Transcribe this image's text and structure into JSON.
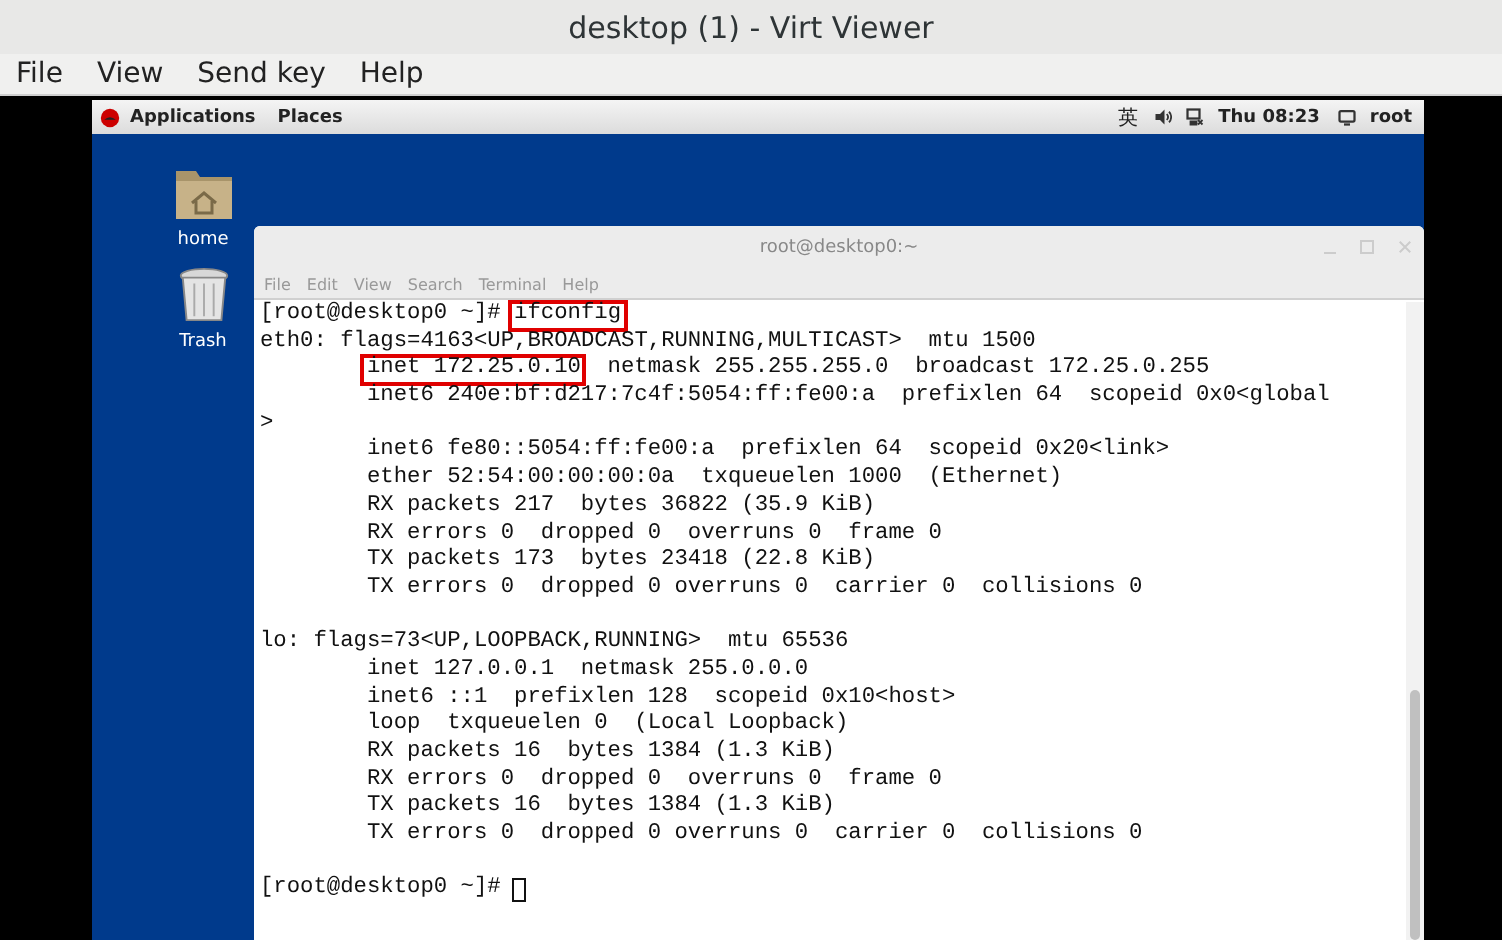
{
  "window": {
    "title": "desktop (1) - Virt Viewer"
  },
  "menu": [
    "File",
    "View",
    "Send key",
    "Help"
  ],
  "guest": {
    "panel": {
      "items": [
        "Applications",
        "Places"
      ],
      "input_method": "英",
      "clock": "Thu 08:23",
      "user": "root"
    },
    "desktop_icons": [
      {
        "kind": "folder",
        "label": "home"
      },
      {
        "kind": "trash",
        "label": "Trash"
      }
    ],
    "terminal": {
      "title": "root@desktop0:~",
      "menu": [
        "File",
        "Edit",
        "View",
        "Search",
        "Terminal",
        "Help"
      ],
      "cursor": true,
      "lines": [
        {
          "indented": false,
          "gap_before": false,
          "parts": [
            {
              "text": "[root@desktop0 ~]# ",
              "boxed": false
            },
            {
              "text": "ifconfig",
              "boxed": true
            }
          ]
        },
        {
          "indented": false,
          "gap_before": false,
          "parts": [
            {
              "text": "eth0: flags=4163<UP,BROADCAST,RUNNING,MULTICAST>  mtu 1500",
              "boxed": false
            }
          ]
        },
        {
          "indented": true,
          "gap_before": false,
          "parts": [
            {
              "text": "inet 172.25.0.10",
              "boxed": true
            },
            {
              "text": "  netmask 255.255.255.0  broadcast 172.25.0.255",
              "boxed": false
            }
          ]
        },
        {
          "indented": true,
          "gap_before": false,
          "parts": [
            {
              "text": "inet6 240e:bf:d217:7c4f:5054:ff:fe00:a  prefixlen 64  scopeid 0x0<global",
              "boxed": false
            }
          ]
        },
        {
          "indented": false,
          "gap_before": false,
          "parts": [
            {
              "text": ">",
              "boxed": false
            }
          ]
        },
        {
          "indented": true,
          "gap_before": false,
          "parts": [
            {
              "text": "inet6 fe80::5054:ff:fe00:a  prefixlen 64  scopeid 0x20<link>",
              "boxed": false
            }
          ]
        },
        {
          "indented": true,
          "gap_before": false,
          "parts": [
            {
              "text": "ether 52:54:00:00:00:0a  txqueuelen 1000  (Ethernet)",
              "boxed": false
            }
          ]
        },
        {
          "indented": true,
          "gap_before": false,
          "parts": [
            {
              "text": "RX packets 217  bytes 36822 (35.9 KiB)",
              "boxed": false
            }
          ]
        },
        {
          "indented": true,
          "gap_before": false,
          "parts": [
            {
              "text": "RX errors 0  dropped 0  overruns 0  frame 0",
              "boxed": false
            }
          ]
        },
        {
          "indented": true,
          "gap_before": false,
          "parts": [
            {
              "text": "TX packets 173  bytes 23418 (22.8 KiB)",
              "boxed": false
            }
          ]
        },
        {
          "indented": true,
          "gap_before": false,
          "parts": [
            {
              "text": "TX errors 0  dropped 0 overruns 0  carrier 0  collisions 0",
              "boxed": false
            }
          ]
        },
        {
          "indented": false,
          "gap_before": true,
          "parts": [
            {
              "text": "lo: flags=73<UP,LOOPBACK,RUNNING>  mtu 65536",
              "boxed": false
            }
          ]
        },
        {
          "indented": true,
          "gap_before": false,
          "parts": [
            {
              "text": "inet 127.0.0.1  netmask 255.0.0.0",
              "boxed": false
            }
          ]
        },
        {
          "indented": true,
          "gap_before": false,
          "parts": [
            {
              "text": "inet6 ::1  prefixlen 128  scopeid 0x10<host>",
              "boxed": false
            }
          ]
        },
        {
          "indented": true,
          "gap_before": false,
          "parts": [
            {
              "text": "loop  txqueuelen 0  (Local Loopback)",
              "boxed": false
            }
          ]
        },
        {
          "indented": true,
          "gap_before": false,
          "parts": [
            {
              "text": "RX packets 16  bytes 1384 (1.3 KiB)",
              "boxed": false
            }
          ]
        },
        {
          "indented": true,
          "gap_before": false,
          "parts": [
            {
              "text": "RX errors 0  dropped 0  overruns 0  frame 0",
              "boxed": false
            }
          ]
        },
        {
          "indented": true,
          "gap_before": false,
          "parts": [
            {
              "text": "TX packets 16  bytes 1384 (1.3 KiB)",
              "boxed": false
            }
          ]
        },
        {
          "indented": true,
          "gap_before": false,
          "parts": [
            {
              "text": "TX errors 0  dropped 0 overruns 0  carrier 0  collisions 0",
              "boxed": false
            }
          ]
        },
        {
          "indented": false,
          "gap_before": true,
          "parts": [
            {
              "text": "[root@desktop0 ~]#",
              "boxed": false
            }
          ]
        }
      ]
    }
  }
}
